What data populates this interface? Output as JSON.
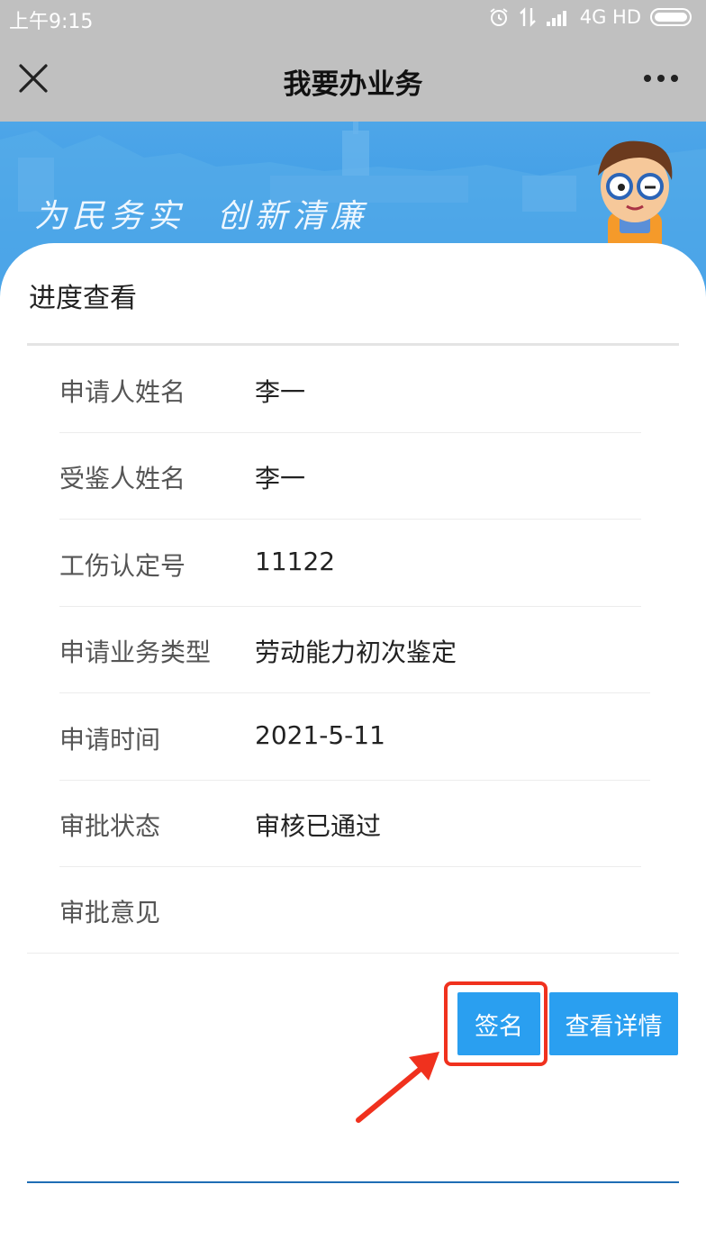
{
  "status_bar": {
    "time": "上午9:15",
    "network": "4G HD"
  },
  "nav": {
    "title": "我要办业务",
    "close_icon": "close-icon",
    "more_icon": "more-icon"
  },
  "banner": {
    "slogan": "为民务实  创新清廉"
  },
  "card": {
    "title": "进度查看",
    "rows": [
      {
        "label": "申请人姓名",
        "value": "李一"
      },
      {
        "label": "受鉴人姓名",
        "value": "李一"
      },
      {
        "label": "工伤认定号",
        "value": "11122"
      },
      {
        "label": "申请业务类型",
        "value": "劳动能力初次鉴定"
      },
      {
        "label": "申请时间",
        "value": "2021-5-11"
      },
      {
        "label": "审批状态",
        "value": "审核已通过"
      },
      {
        "label": "审批意见",
        "value": ""
      }
    ],
    "buttons": {
      "sign": "签名",
      "detail": "查看详情"
    }
  },
  "colors": {
    "accent": "#2a9ff0",
    "highlight": "#f0311e",
    "bar": "#c0c0c0"
  }
}
